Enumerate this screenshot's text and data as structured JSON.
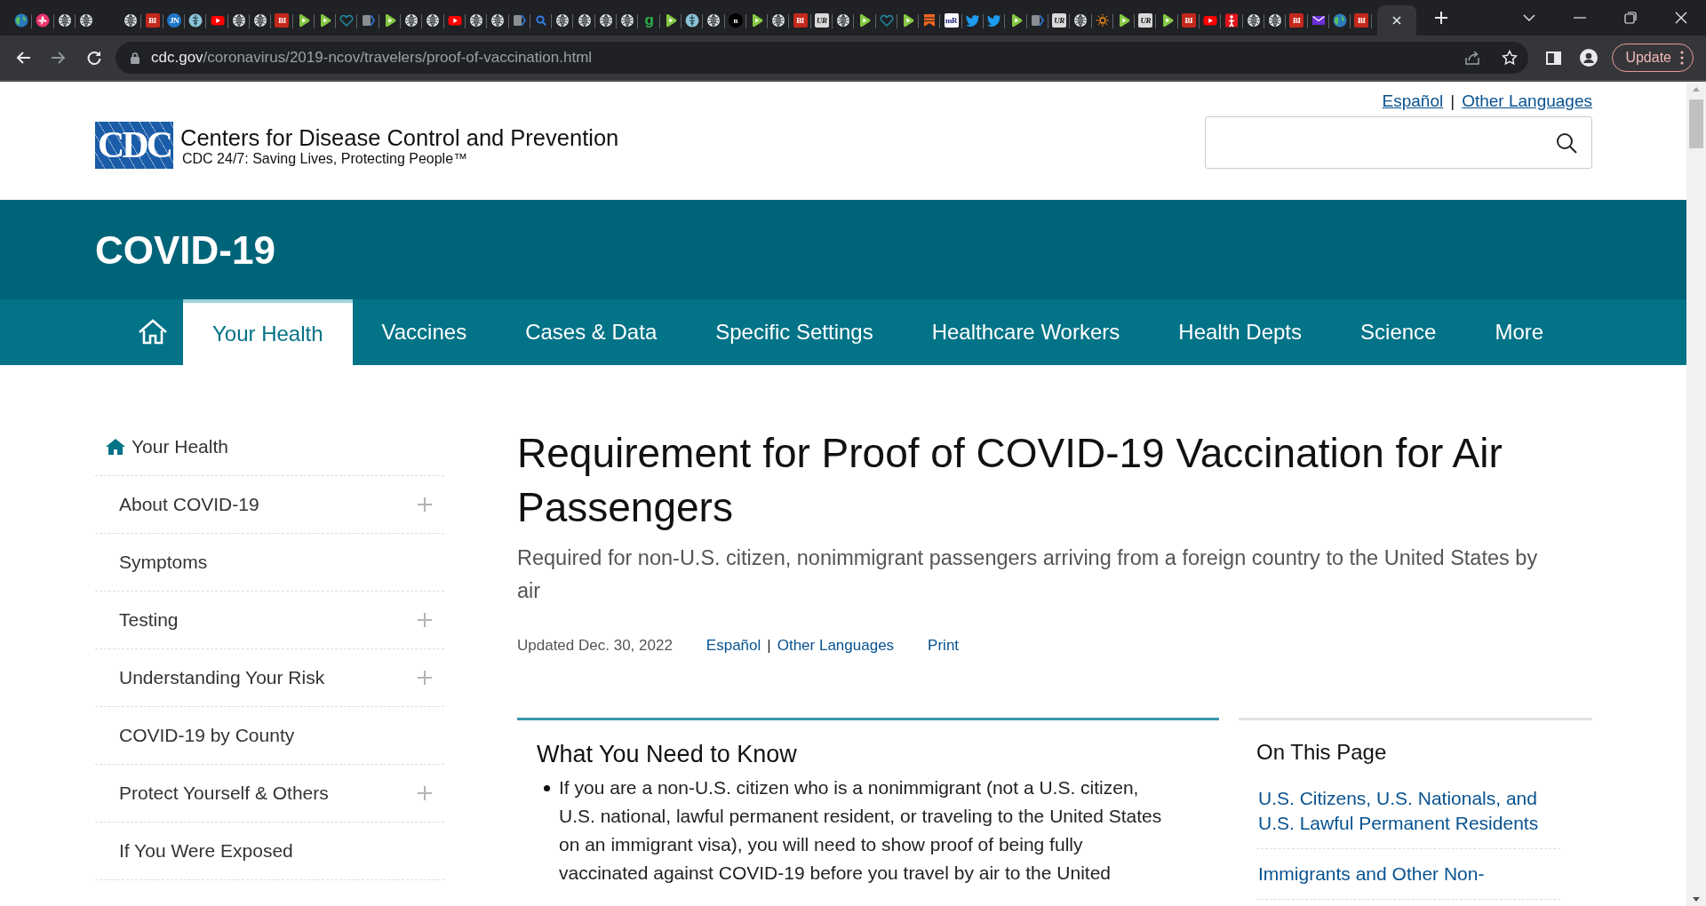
{
  "browser": {
    "tabs": [
      {
        "kind": "earth",
        "pinned": true,
        "selected": false
      },
      {
        "kind": "flower",
        "pinned": true,
        "selected": false
      },
      {
        "kind": "globe",
        "pinned": true,
        "selected": false
      },
      {
        "kind": "globe",
        "pinned": true,
        "selected": false
      },
      {
        "kind": "globe",
        "selected": false
      },
      {
        "kind": "letter",
        "label": "BI",
        "color": "#c4281c",
        "selected": false
      },
      {
        "kind": "letter",
        "label": "JN",
        "color": "#1f77c9",
        "selected": false
      },
      {
        "kind": "caduceus",
        "selected": false
      },
      {
        "kind": "youtube",
        "selected": false
      },
      {
        "kind": "globe",
        "selected": false
      },
      {
        "kind": "globe",
        "selected": false
      },
      {
        "kind": "letter",
        "label": "BI",
        "color": "#c4281c",
        "selected": false
      },
      {
        "kind": "play",
        "selected": false
      },
      {
        "kind": "play",
        "selected": false
      },
      {
        "kind": "heart",
        "selected": false
      },
      {
        "kind": "arrow",
        "selected": false
      },
      {
        "kind": "play",
        "selected": false
      },
      {
        "kind": "globe",
        "selected": false
      },
      {
        "kind": "globe",
        "selected": false
      },
      {
        "kind": "youtube",
        "selected": false
      },
      {
        "kind": "globe",
        "selected": false
      },
      {
        "kind": "globe",
        "selected": false
      },
      {
        "kind": "arrow",
        "selected": false
      },
      {
        "kind": "search",
        "selected": false
      },
      {
        "kind": "globe",
        "selected": false
      },
      {
        "kind": "globe",
        "selected": false
      },
      {
        "kind": "globe",
        "selected": false
      },
      {
        "kind": "globe",
        "selected": false
      },
      {
        "kind": "letter",
        "label": "g",
        "color": "#2bb24c",
        "selected": false
      },
      {
        "kind": "play",
        "selected": false
      },
      {
        "kind": "caduceus",
        "selected": false
      },
      {
        "kind": "globe",
        "selected": false
      },
      {
        "kind": "letter",
        "label": "n",
        "color": "#000000",
        "selected": false
      },
      {
        "kind": "play",
        "selected": false
      },
      {
        "kind": "globe",
        "selected": false
      },
      {
        "kind": "letter",
        "label": "BI",
        "color": "#c4281c",
        "selected": false
      },
      {
        "kind": "letter",
        "label": "UR",
        "color": "#d9d9d9",
        "selected": false
      },
      {
        "kind": "globe",
        "selected": false
      },
      {
        "kind": "play",
        "selected": false
      },
      {
        "kind": "heart",
        "selected": false
      },
      {
        "kind": "play",
        "selected": false
      },
      {
        "kind": "bookmark",
        "selected": false
      },
      {
        "kind": "letter",
        "label": "mR",
        "color": "#ffffff",
        "selected": false
      },
      {
        "kind": "twitter",
        "selected": false
      },
      {
        "kind": "twitter",
        "selected": false
      },
      {
        "kind": "play",
        "selected": false
      },
      {
        "kind": "arrow",
        "selected": false
      },
      {
        "kind": "letter",
        "label": "UR",
        "color": "#d9d9d9",
        "selected": false
      },
      {
        "kind": "globe",
        "selected": false
      },
      {
        "kind": "sun",
        "selected": false
      },
      {
        "kind": "play",
        "selected": false
      },
      {
        "kind": "letter",
        "label": "UR",
        "color": "#d9d9d9",
        "selected": false
      },
      {
        "kind": "play",
        "selected": false
      },
      {
        "kind": "letter",
        "label": "BI",
        "color": "#c4281c",
        "selected": false
      },
      {
        "kind": "youtube",
        "selected": false
      },
      {
        "kind": "figure",
        "selected": false
      },
      {
        "kind": "globe",
        "selected": false
      },
      {
        "kind": "globe",
        "selected": false
      },
      {
        "kind": "letter",
        "label": "BI",
        "color": "#c4281c",
        "selected": false
      },
      {
        "kind": "mail",
        "selected": false
      },
      {
        "kind": "earth",
        "selected": false
      },
      {
        "kind": "letter",
        "label": "BI",
        "color": "#c4281c",
        "selected": false
      },
      {
        "kind": "blank",
        "selected": true
      }
    ],
    "address": {
      "host": "cdc.gov",
      "path": "/coronavirus/2019-ncov/travelers/proof-of-vaccination.html"
    },
    "update_button": "Update"
  },
  "header": {
    "language_links": [
      "Español",
      "Other Languages"
    ],
    "separator": "|",
    "logo": {
      "mark": "CDC",
      "title": "Centers for Disease Control and Prevention",
      "tagline": "CDC 24/7: Saving Lives, Protecting People™"
    }
  },
  "banner": {
    "title": "COVID-19"
  },
  "nav": [
    {
      "kind": "home",
      "selected": false
    },
    {
      "kind": "link",
      "label": "Your Health",
      "selected": true
    },
    {
      "kind": "link",
      "label": "Vaccines",
      "selected": false
    },
    {
      "kind": "link",
      "label": "Cases & Data",
      "selected": false
    },
    {
      "kind": "link",
      "label": "Specific Settings",
      "selected": false
    },
    {
      "kind": "link",
      "label": "Healthcare Workers",
      "selected": false
    },
    {
      "kind": "link",
      "label": "Health Depts",
      "selected": false
    },
    {
      "kind": "link",
      "label": "Science",
      "selected": false
    },
    {
      "kind": "link",
      "label": "More",
      "selected": false
    }
  ],
  "sidebar": {
    "items": [
      {
        "kind": "home",
        "label": "Your Health"
      },
      {
        "kind": "expandable",
        "label": "About COVID-19"
      },
      {
        "kind": "link",
        "label": "Symptoms"
      },
      {
        "kind": "expandable",
        "label": "Testing"
      },
      {
        "kind": "expandable",
        "label": "Understanding Your Risk"
      },
      {
        "kind": "link",
        "label": "COVID-19 by County"
      },
      {
        "kind": "expandable",
        "label": "Protect Yourself & Others"
      },
      {
        "kind": "link",
        "label": "If You Were Exposed"
      }
    ]
  },
  "article": {
    "title": "Requirement for Proof of COVID-19 Vaccination for Air Passengers",
    "subtitle": "Required for non-U.S. citizen, nonimmigrant passengers arriving from a foreign country to the United States by air",
    "updated": "Updated Dec. 30, 2022",
    "language_links": [
      "Español",
      "Other Languages"
    ],
    "separator": "|",
    "print": "Print",
    "summary": {
      "heading": "What You Need to Know",
      "bullets": [
        "If you are a non-U.S. citizen who is a nonimmigrant (not a U.S. citizen, U.S. national, lawful permanent resident, or traveling to the United States on an immigrant visa), you will need to show proof of being fully vaccinated against COVID-19 before you travel by air to the United"
      ]
    }
  },
  "on_this_page": {
    "heading": "On This Page",
    "links": [
      "U.S. Citizens, U.S. Nationals, and U.S. Lawful Permanent Residents",
      "Immigrants and Other Non-"
    ]
  }
}
